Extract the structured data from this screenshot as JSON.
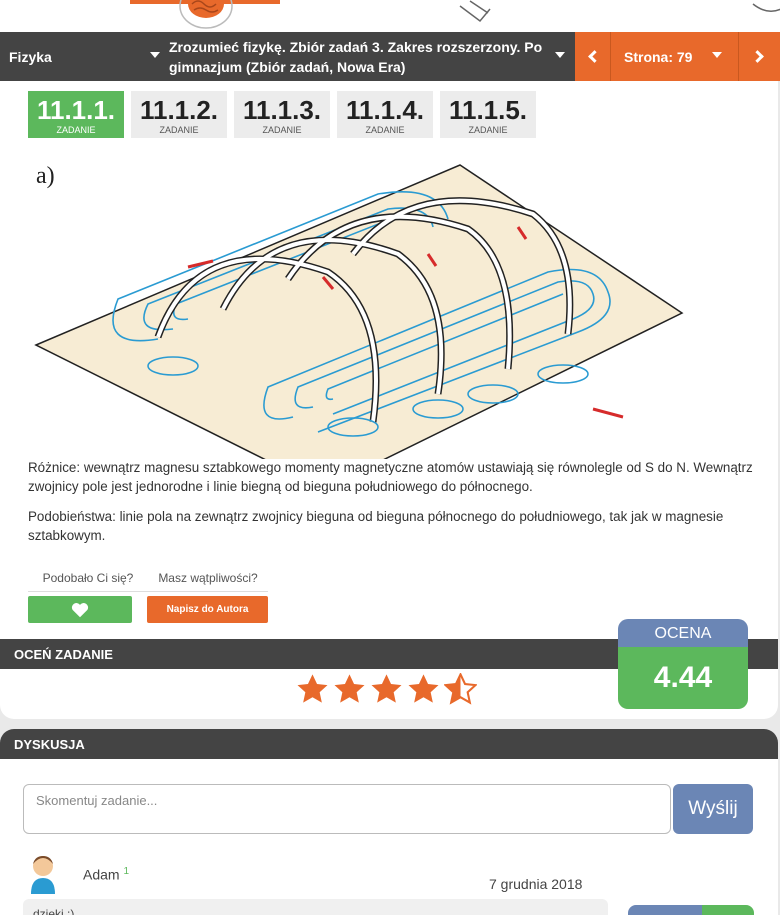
{
  "nav": {
    "subject": "Fizyka",
    "book": "Zrozumieć fizykę. Zbiór zadań 3. Zakres rozszerzony. Po gimnazjum (Zbiór zadań, Nowa Era)",
    "page_label": "Strona: 79"
  },
  "tabs": [
    {
      "num": "11.1.1.",
      "label": "ZADANIE",
      "active": true
    },
    {
      "num": "11.1.2.",
      "label": "ZADANIE",
      "active": false
    },
    {
      "num": "11.1.3.",
      "label": "ZADANIE",
      "active": false
    },
    {
      "num": "11.1.4.",
      "label": "ZADANIE",
      "active": false
    },
    {
      "num": "11.1.5.",
      "label": "ZADANIE",
      "active": false
    }
  ],
  "figure": {
    "label": "a)"
  },
  "solution": {
    "differences": "Różnice: wewnątrz magnesu sztabkowego momenty magnetyczne atomów ustawiają się równolegle od S do N. Wewnątrz zwojnicy pole jest jednorodne i linie biegną od bieguna południowego do północnego.",
    "similarities": "Podobieństwa: linie pola na zewnątrz zwojnicy bieguna od bieguna północnego do południowego, tak jak w magnesie sztabkowym."
  },
  "feedback": {
    "liked_label": "Podobało Ci się?",
    "doubt_label": "Masz wątpliwości?",
    "author_button": "Napisz do Autora"
  },
  "rating": {
    "bar_label": "OCEŃ ZADANIE",
    "score_label": "OCENA",
    "score": "4.44",
    "stars": 4.44
  },
  "discussion": {
    "bar_label": "DYSKUSJA",
    "placeholder": "Skomentuj zadanie...",
    "send_label": "Wyślij",
    "comment": {
      "user": "Adam",
      "user_badge": "1",
      "date": "7 grudnia 2018",
      "text": "dzieki :)"
    }
  },
  "colors": {
    "accent_orange": "#e8692b",
    "green": "#5cb85c",
    "dark": "#444444",
    "blue": "#6b86b5"
  }
}
